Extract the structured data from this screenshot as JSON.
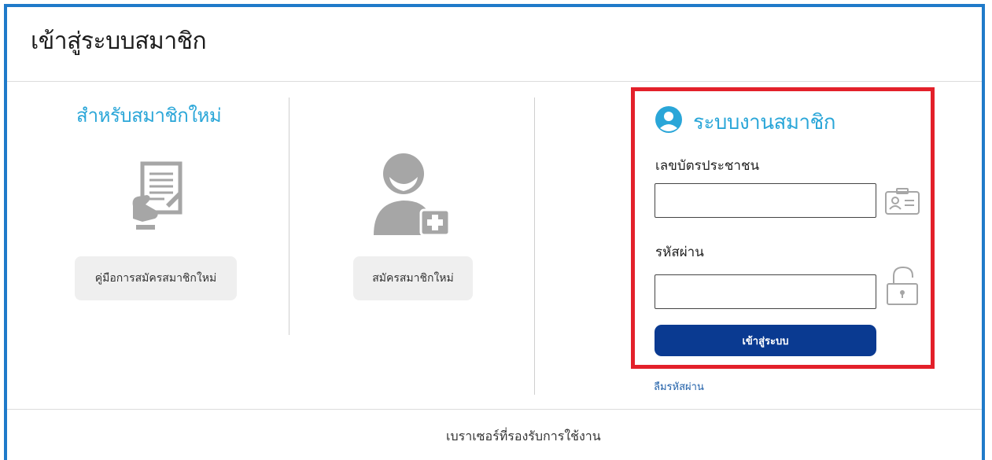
{
  "header": {
    "title": "เข้าสู่ระบบสมาชิก"
  },
  "new_member": {
    "title": "สำหรับสมาชิกใหม่",
    "guide_button": "คู่มือการสมัครสมาชิกใหม่",
    "register_button": "สมัครสมาชิกใหม่"
  },
  "login": {
    "heading": "ระบบงานสมาชิก",
    "id_label": "เลขบัตรประชาชน",
    "id_value": "",
    "password_label": "รหัสผ่าน",
    "password_value": "",
    "submit_label": "เข้าสู่ระบบ",
    "forgot_link": "ลืมรหัสผ่าน"
  },
  "footer": {
    "browsers_link": "เบราเซอร์ที่รองรับการใช้งาน"
  },
  "colors": {
    "frame_border": "#1f7ac9",
    "accent": "#2aa6d8",
    "primary_button": "#0a3a91",
    "highlight_box": "#e3202a",
    "icon_gray": "#a6a6a6"
  },
  "icons": {
    "guide": "document-hand-icon",
    "register": "user-add-icon",
    "login_heading": "user-circle-icon",
    "id_field": "id-card-icon",
    "password_field": "unlock-icon"
  }
}
